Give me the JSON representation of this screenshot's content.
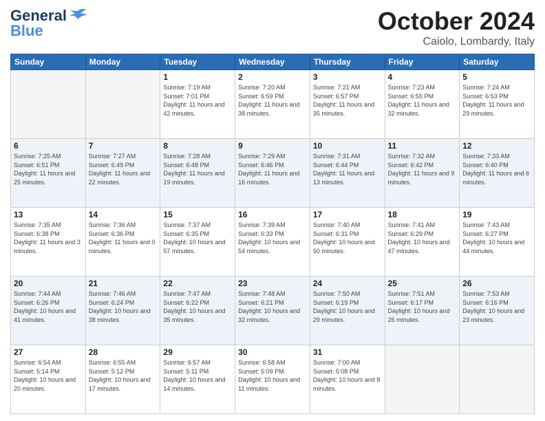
{
  "header": {
    "logo_line1": "General",
    "logo_line2": "Blue",
    "title": "October 2024",
    "location": "Caiolo, Lombardy, Italy"
  },
  "weekdays": [
    "Sunday",
    "Monday",
    "Tuesday",
    "Wednesday",
    "Thursday",
    "Friday",
    "Saturday"
  ],
  "weeks": [
    [
      {
        "day": "",
        "empty": true
      },
      {
        "day": "",
        "empty": true
      },
      {
        "day": "1",
        "sunrise": "7:19 AM",
        "sunset": "7:01 PM",
        "daylight": "11 hours and 42 minutes."
      },
      {
        "day": "2",
        "sunrise": "7:20 AM",
        "sunset": "6:59 PM",
        "daylight": "11 hours and 38 minutes."
      },
      {
        "day": "3",
        "sunrise": "7:21 AM",
        "sunset": "6:57 PM",
        "daylight": "11 hours and 35 minutes."
      },
      {
        "day": "4",
        "sunrise": "7:23 AM",
        "sunset": "6:55 PM",
        "daylight": "11 hours and 32 minutes."
      },
      {
        "day": "5",
        "sunrise": "7:24 AM",
        "sunset": "6:53 PM",
        "daylight": "11 hours and 29 minutes."
      }
    ],
    [
      {
        "day": "6",
        "sunrise": "7:25 AM",
        "sunset": "6:51 PM",
        "daylight": "11 hours and 25 minutes."
      },
      {
        "day": "7",
        "sunrise": "7:27 AM",
        "sunset": "6:49 PM",
        "daylight": "11 hours and 22 minutes."
      },
      {
        "day": "8",
        "sunrise": "7:28 AM",
        "sunset": "6:48 PM",
        "daylight": "11 hours and 19 minutes."
      },
      {
        "day": "9",
        "sunrise": "7:29 AM",
        "sunset": "6:46 PM",
        "daylight": "11 hours and 16 minutes."
      },
      {
        "day": "10",
        "sunrise": "7:31 AM",
        "sunset": "6:44 PM",
        "daylight": "11 hours and 13 minutes."
      },
      {
        "day": "11",
        "sunrise": "7:32 AM",
        "sunset": "6:42 PM",
        "daylight": "11 hours and 9 minutes."
      },
      {
        "day": "12",
        "sunrise": "7:33 AM",
        "sunset": "6:40 PM",
        "daylight": "11 hours and 6 minutes."
      }
    ],
    [
      {
        "day": "13",
        "sunrise": "7:35 AM",
        "sunset": "6:38 PM",
        "daylight": "11 hours and 3 minutes."
      },
      {
        "day": "14",
        "sunrise": "7:36 AM",
        "sunset": "6:36 PM",
        "daylight": "11 hours and 0 minutes."
      },
      {
        "day": "15",
        "sunrise": "7:37 AM",
        "sunset": "6:35 PM",
        "daylight": "10 hours and 57 minutes."
      },
      {
        "day": "16",
        "sunrise": "7:39 AM",
        "sunset": "6:33 PM",
        "daylight": "10 hours and 54 minutes."
      },
      {
        "day": "17",
        "sunrise": "7:40 AM",
        "sunset": "6:31 PM",
        "daylight": "10 hours and 50 minutes."
      },
      {
        "day": "18",
        "sunrise": "7:41 AM",
        "sunset": "6:29 PM",
        "daylight": "10 hours and 47 minutes."
      },
      {
        "day": "19",
        "sunrise": "7:43 AM",
        "sunset": "6:27 PM",
        "daylight": "10 hours and 44 minutes."
      }
    ],
    [
      {
        "day": "20",
        "sunrise": "7:44 AM",
        "sunset": "6:26 PM",
        "daylight": "10 hours and 41 minutes."
      },
      {
        "day": "21",
        "sunrise": "7:46 AM",
        "sunset": "6:24 PM",
        "daylight": "10 hours and 38 minutes."
      },
      {
        "day": "22",
        "sunrise": "7:47 AM",
        "sunset": "6:22 PM",
        "daylight": "10 hours and 35 minutes."
      },
      {
        "day": "23",
        "sunrise": "7:48 AM",
        "sunset": "6:21 PM",
        "daylight": "10 hours and 32 minutes."
      },
      {
        "day": "24",
        "sunrise": "7:50 AM",
        "sunset": "6:19 PM",
        "daylight": "10 hours and 29 minutes."
      },
      {
        "day": "25",
        "sunrise": "7:51 AM",
        "sunset": "6:17 PM",
        "daylight": "10 hours and 26 minutes."
      },
      {
        "day": "26",
        "sunrise": "7:53 AM",
        "sunset": "6:16 PM",
        "daylight": "10 hours and 23 minutes."
      }
    ],
    [
      {
        "day": "27",
        "sunrise": "6:54 AM",
        "sunset": "5:14 PM",
        "daylight": "10 hours and 20 minutes."
      },
      {
        "day": "28",
        "sunrise": "6:55 AM",
        "sunset": "5:12 PM",
        "daylight": "10 hours and 17 minutes."
      },
      {
        "day": "29",
        "sunrise": "6:57 AM",
        "sunset": "5:11 PM",
        "daylight": "10 hours and 14 minutes."
      },
      {
        "day": "30",
        "sunrise": "6:58 AM",
        "sunset": "5:09 PM",
        "daylight": "10 hours and 11 minutes."
      },
      {
        "day": "31",
        "sunrise": "7:00 AM",
        "sunset": "5:08 PM",
        "daylight": "10 hours and 8 minutes."
      },
      {
        "day": "",
        "empty": true
      },
      {
        "day": "",
        "empty": true
      }
    ]
  ],
  "labels": {
    "sunrise": "Sunrise:",
    "sunset": "Sunset:",
    "daylight": "Daylight:"
  }
}
